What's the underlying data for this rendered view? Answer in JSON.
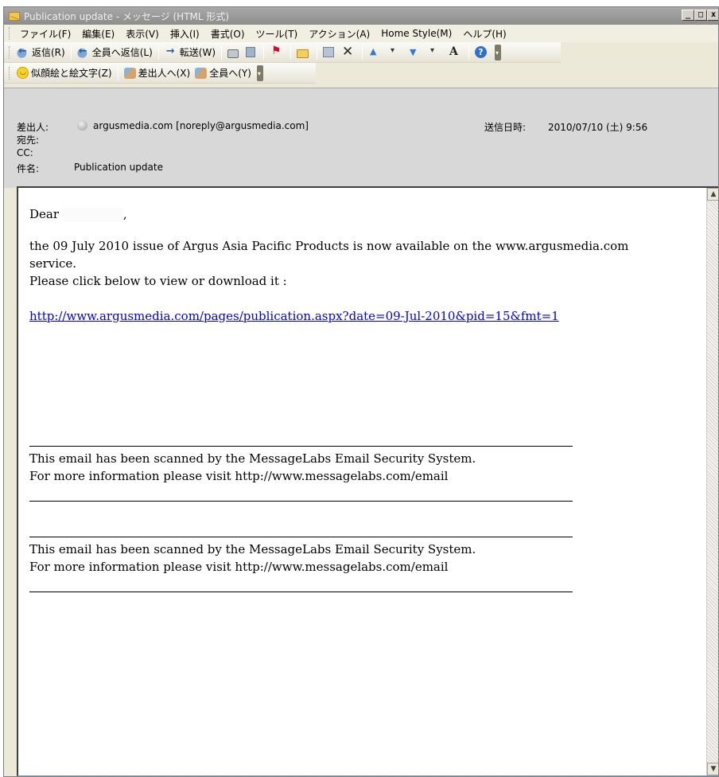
{
  "window": {
    "title": "Publication update - メッセージ (HTML 形式)",
    "controls": {
      "minimize": "_",
      "maximize": "□",
      "close": "x"
    }
  },
  "menu": {
    "items": [
      "ファイル(F)",
      "編集(E)",
      "表示(V)",
      "挿入(I)",
      "書式(O)",
      "ツール(T)",
      "アクション(A)",
      "Home Style(M)",
      "ヘルプ(H)"
    ]
  },
  "toolbar1": {
    "reply_label": "返信(R)",
    "reply_all_label": "全員へ返信(L)",
    "forward_label": "転送(W)",
    "help_glyph": "?"
  },
  "toolbar2": {
    "emoji_label": "似顔絵と絵文字(Z)",
    "to_sender_label": "差出人へ(X)",
    "to_all_label": "全員へ(Y)"
  },
  "header": {
    "from_label": "差出人:",
    "from_value": "argusmedia.com [noreply@argusmedia.com]",
    "sent_label": "送信日時:",
    "sent_value": "2010/07/10 (土) 9:56",
    "to_label": "宛先:",
    "to_value": "",
    "cc_label": "CC:",
    "cc_value": "",
    "subject_label": "件名:",
    "subject_value": "Publication update"
  },
  "message": {
    "greeting_prefix": "Dear",
    "greeting_suffix": ",",
    "line1": "the 09 July 2010 issue of Argus Asia Pacific Products is now available on the www.argusmedia.com service.",
    "line2": "Please click below to view or download it :",
    "link": "http://www.argusmedia.com/pages/publication.aspx?date=09-Jul-2010&pid=15&fmt=1",
    "disclaimer1_line1": "This email has been scanned by the MessageLabs Email Security System.",
    "disclaimer1_line2": "For more information please visit http://www.messagelabs.com/email",
    "disclaimer2_line1": "This email has been scanned by the MessageLabs Email Security System.",
    "disclaimer2_line2": "For more information please visit http://www.messagelabs.com/email"
  }
}
